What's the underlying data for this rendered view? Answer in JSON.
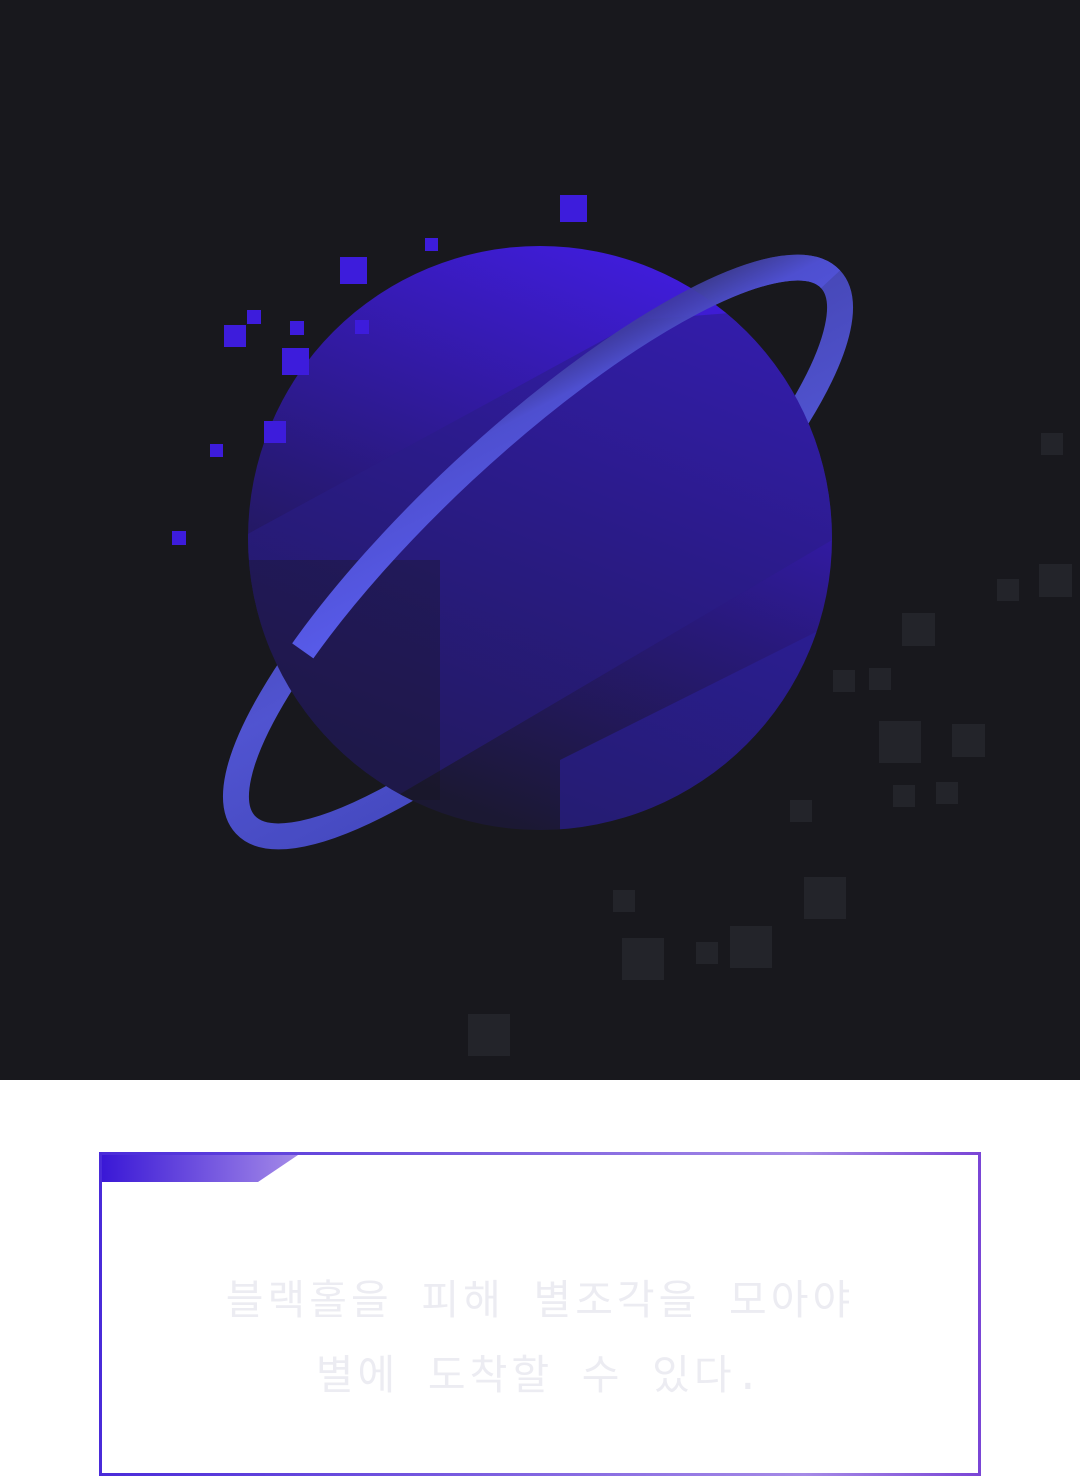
{
  "hero": {
    "illustration": "pixel-planet-with-ring",
    "colors": {
      "background": "#18181d",
      "planet_top": "#3f1cd8",
      "planet_bottom": "#211a4a",
      "ring": "#5a5ef0",
      "pixel_accent": "#3d1cdc",
      "pixel_dark": "#23242a"
    }
  },
  "caption": {
    "line1": "블랙홀을 피해 별조각을 모아야",
    "line2": "별에 도착할 수 있다.",
    "colors": {
      "text": "#ececf2",
      "border_start": "#4a2bd9",
      "border_end": "#7a45d6",
      "tab_start": "#3a18d6",
      "tab_end": "#a48ae8"
    }
  }
}
